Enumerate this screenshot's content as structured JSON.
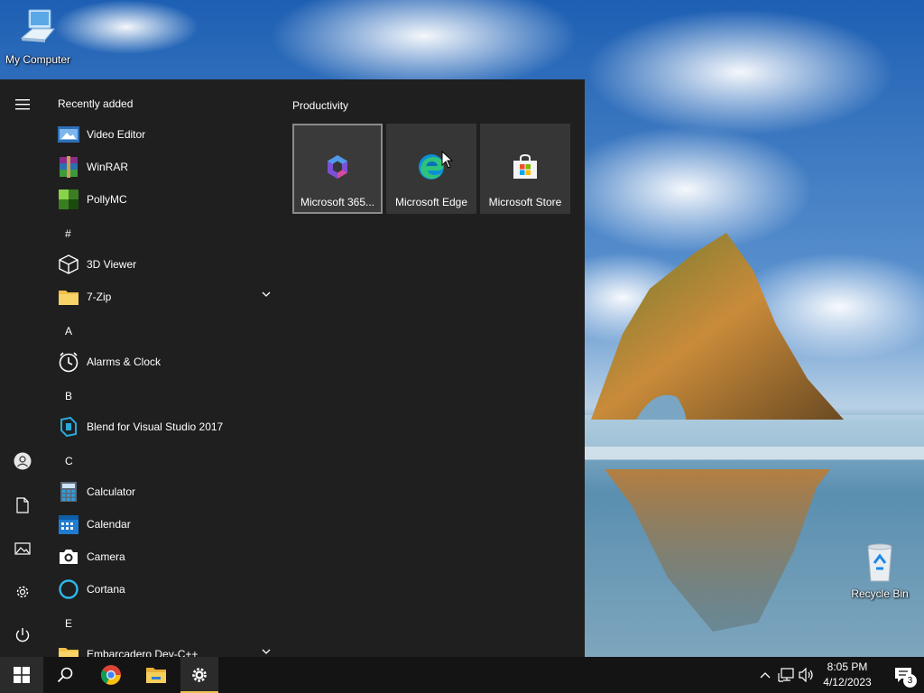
{
  "desktop": {
    "icons": [
      {
        "label": "My Computer"
      },
      {
        "label": "Recycle Bin"
      }
    ]
  },
  "start_menu": {
    "recently_added_header": "Recently added",
    "recently_added": [
      {
        "label": "Video Editor",
        "icon": "video-editor-icon"
      },
      {
        "label": "WinRAR",
        "icon": "winrar-icon"
      },
      {
        "label": "PollyMC",
        "icon": "pollymc-icon"
      }
    ],
    "sections": [
      {
        "letter": "#",
        "apps": [
          {
            "label": "3D Viewer",
            "icon": "cube-icon"
          },
          {
            "label": "7-Zip",
            "icon": "folder-icon",
            "expandable": true
          }
        ]
      },
      {
        "letter": "A",
        "apps": [
          {
            "label": "Alarms & Clock",
            "icon": "clock-icon"
          }
        ]
      },
      {
        "letter": "B",
        "apps": [
          {
            "label": "Blend for Visual Studio 2017",
            "icon": "blend-icon"
          }
        ]
      },
      {
        "letter": "C",
        "apps": [
          {
            "label": "Calculator",
            "icon": "calculator-icon"
          },
          {
            "label": "Calendar",
            "icon": "calendar-icon"
          },
          {
            "label": "Camera",
            "icon": "camera-icon"
          },
          {
            "label": "Cortana",
            "icon": "cortana-icon"
          }
        ]
      },
      {
        "letter": "E",
        "apps": [
          {
            "label": "Embarcadero Dev-C++",
            "icon": "folder-icon",
            "expandable": true
          }
        ]
      }
    ],
    "tile_group": {
      "title": "Productivity",
      "tiles": [
        {
          "label": "Microsoft 365...",
          "icon": "microsoft-365-icon",
          "selected": true
        },
        {
          "label": "Microsoft Edge",
          "icon": "edge-icon",
          "selected": false
        },
        {
          "label": "Microsoft Store",
          "icon": "store-icon",
          "selected": false
        }
      ]
    }
  },
  "taskbar": {
    "clock_time": "8:05 PM",
    "clock_date": "4/12/2023",
    "notification_count": "3"
  },
  "colors": {
    "start_bg": "#1f1f1f",
    "tile_bg": "#363636",
    "taskbar_bg": "#141414",
    "active_indicator": "#f0c050"
  }
}
